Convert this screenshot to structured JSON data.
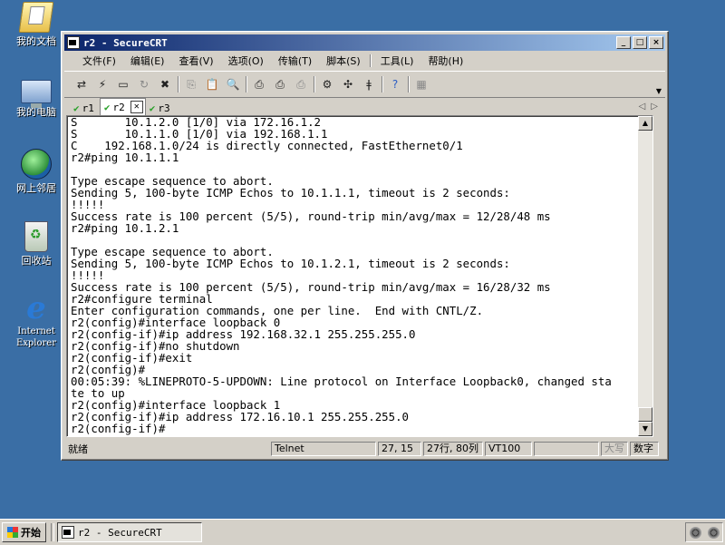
{
  "desktop": {
    "icons": [
      {
        "label": "我的文档",
        "icon": "my-documents-icon"
      },
      {
        "label": "我的电脑",
        "icon": "my-computer-icon"
      },
      {
        "label": "网上邻居",
        "icon": "network-places-icon"
      },
      {
        "label": "回收站",
        "icon": "recycle-bin-icon"
      },
      {
        "label": "Internet Explorer",
        "icon": "internet-explorer-icon"
      }
    ]
  },
  "window": {
    "title": "r2 - SecureCRT",
    "buttons": {
      "minimize": "_",
      "maximize": "□",
      "close": "×"
    }
  },
  "menu": {
    "items": [
      "文件(F)",
      "编辑(E)",
      "查看(V)",
      "选项(O)",
      "传输(T)",
      "脚本(S)",
      "工具(L)",
      "帮助(H)"
    ]
  },
  "tabs": [
    {
      "label": "r1",
      "status": "connected"
    },
    {
      "label": "r2",
      "status": "connected",
      "active": true
    },
    {
      "label": "r3",
      "status": "connected"
    }
  ],
  "terminal": {
    "lines": [
      "S       10.1.2.0 [1/0] via 172.16.1.2",
      "S       10.1.1.0 [1/0] via 192.168.1.1",
      "C    192.168.1.0/24 is directly connected, FastEthernet0/1",
      "r2#ping 10.1.1.1",
      "",
      "Type escape sequence to abort.",
      "Sending 5, 100-byte ICMP Echos to 10.1.1.1, timeout is 2 seconds:",
      "!!!!!",
      "Success rate is 100 percent (5/5), round-trip min/avg/max = 12/28/48 ms",
      "r2#ping 10.1.2.1",
      "",
      "Type escape sequence to abort.",
      "Sending 5, 100-byte ICMP Echos to 10.1.2.1, timeout is 2 seconds:",
      "!!!!!",
      "Success rate is 100 percent (5/5), round-trip min/avg/max = 16/28/32 ms",
      "r2#configure terminal",
      "Enter configuration commands, one per line.  End with CNTL/Z.",
      "r2(config)#interface loopback 0",
      "r2(config-if)#ip address 192.168.32.1 255.255.255.0",
      "r2(config-if)#no shutdown",
      "r2(config-if)#exit",
      "r2(config)#",
      "00:05:39: %LINEPROTO-5-UPDOWN: Line protocol on Interface Loopback0, changed sta",
      "te to up",
      "r2(config)#interface loopback 1",
      "r2(config-if)#ip address 172.16.10.1 255.255.255.0",
      "r2(config-if)#"
    ]
  },
  "status": {
    "text": "就绪",
    "protocol": "Telnet",
    "cursor": "27, 15",
    "size": "27行, 80列",
    "emulation": "VT100",
    "caps": "大写",
    "num": "数字"
  },
  "taskbar": {
    "start_label": "开始",
    "task_label": "r2 - SecureCRT"
  }
}
